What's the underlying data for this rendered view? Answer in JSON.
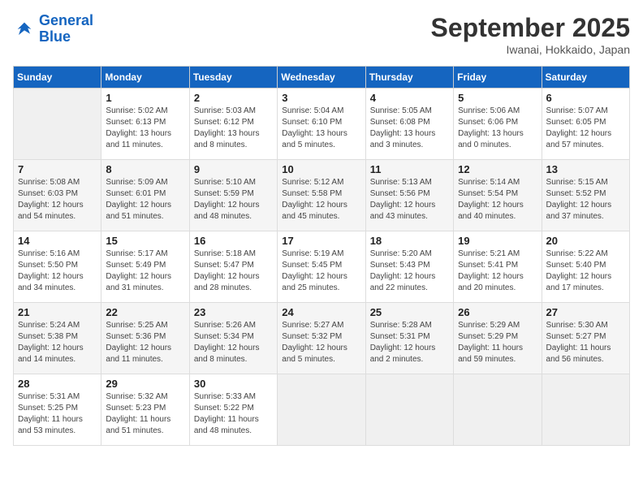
{
  "header": {
    "logo_line1": "General",
    "logo_line2": "Blue",
    "month": "September 2025",
    "location": "Iwanai, Hokkaido, Japan"
  },
  "columns": [
    "Sunday",
    "Monday",
    "Tuesday",
    "Wednesday",
    "Thursday",
    "Friday",
    "Saturday"
  ],
  "weeks": [
    [
      {
        "day": "",
        "info": ""
      },
      {
        "day": "1",
        "info": "Sunrise: 5:02 AM\nSunset: 6:13 PM\nDaylight: 13 hours\nand 11 minutes."
      },
      {
        "day": "2",
        "info": "Sunrise: 5:03 AM\nSunset: 6:12 PM\nDaylight: 13 hours\nand 8 minutes."
      },
      {
        "day": "3",
        "info": "Sunrise: 5:04 AM\nSunset: 6:10 PM\nDaylight: 13 hours\nand 5 minutes."
      },
      {
        "day": "4",
        "info": "Sunrise: 5:05 AM\nSunset: 6:08 PM\nDaylight: 13 hours\nand 3 minutes."
      },
      {
        "day": "5",
        "info": "Sunrise: 5:06 AM\nSunset: 6:06 PM\nDaylight: 13 hours\nand 0 minutes."
      },
      {
        "day": "6",
        "info": "Sunrise: 5:07 AM\nSunset: 6:05 PM\nDaylight: 12 hours\nand 57 minutes."
      }
    ],
    [
      {
        "day": "7",
        "info": "Sunrise: 5:08 AM\nSunset: 6:03 PM\nDaylight: 12 hours\nand 54 minutes."
      },
      {
        "day": "8",
        "info": "Sunrise: 5:09 AM\nSunset: 6:01 PM\nDaylight: 12 hours\nand 51 minutes."
      },
      {
        "day": "9",
        "info": "Sunrise: 5:10 AM\nSunset: 5:59 PM\nDaylight: 12 hours\nand 48 minutes."
      },
      {
        "day": "10",
        "info": "Sunrise: 5:12 AM\nSunset: 5:58 PM\nDaylight: 12 hours\nand 45 minutes."
      },
      {
        "day": "11",
        "info": "Sunrise: 5:13 AM\nSunset: 5:56 PM\nDaylight: 12 hours\nand 43 minutes."
      },
      {
        "day": "12",
        "info": "Sunrise: 5:14 AM\nSunset: 5:54 PM\nDaylight: 12 hours\nand 40 minutes."
      },
      {
        "day": "13",
        "info": "Sunrise: 5:15 AM\nSunset: 5:52 PM\nDaylight: 12 hours\nand 37 minutes."
      }
    ],
    [
      {
        "day": "14",
        "info": "Sunrise: 5:16 AM\nSunset: 5:50 PM\nDaylight: 12 hours\nand 34 minutes."
      },
      {
        "day": "15",
        "info": "Sunrise: 5:17 AM\nSunset: 5:49 PM\nDaylight: 12 hours\nand 31 minutes."
      },
      {
        "day": "16",
        "info": "Sunrise: 5:18 AM\nSunset: 5:47 PM\nDaylight: 12 hours\nand 28 minutes."
      },
      {
        "day": "17",
        "info": "Sunrise: 5:19 AM\nSunset: 5:45 PM\nDaylight: 12 hours\nand 25 minutes."
      },
      {
        "day": "18",
        "info": "Sunrise: 5:20 AM\nSunset: 5:43 PM\nDaylight: 12 hours\nand 22 minutes."
      },
      {
        "day": "19",
        "info": "Sunrise: 5:21 AM\nSunset: 5:41 PM\nDaylight: 12 hours\nand 20 minutes."
      },
      {
        "day": "20",
        "info": "Sunrise: 5:22 AM\nSunset: 5:40 PM\nDaylight: 12 hours\nand 17 minutes."
      }
    ],
    [
      {
        "day": "21",
        "info": "Sunrise: 5:24 AM\nSunset: 5:38 PM\nDaylight: 12 hours\nand 14 minutes."
      },
      {
        "day": "22",
        "info": "Sunrise: 5:25 AM\nSunset: 5:36 PM\nDaylight: 12 hours\nand 11 minutes."
      },
      {
        "day": "23",
        "info": "Sunrise: 5:26 AM\nSunset: 5:34 PM\nDaylight: 12 hours\nand 8 minutes."
      },
      {
        "day": "24",
        "info": "Sunrise: 5:27 AM\nSunset: 5:32 PM\nDaylight: 12 hours\nand 5 minutes."
      },
      {
        "day": "25",
        "info": "Sunrise: 5:28 AM\nSunset: 5:31 PM\nDaylight: 12 hours\nand 2 minutes."
      },
      {
        "day": "26",
        "info": "Sunrise: 5:29 AM\nSunset: 5:29 PM\nDaylight: 11 hours\nand 59 minutes."
      },
      {
        "day": "27",
        "info": "Sunrise: 5:30 AM\nSunset: 5:27 PM\nDaylight: 11 hours\nand 56 minutes."
      }
    ],
    [
      {
        "day": "28",
        "info": "Sunrise: 5:31 AM\nSunset: 5:25 PM\nDaylight: 11 hours\nand 53 minutes."
      },
      {
        "day": "29",
        "info": "Sunrise: 5:32 AM\nSunset: 5:23 PM\nDaylight: 11 hours\nand 51 minutes."
      },
      {
        "day": "30",
        "info": "Sunrise: 5:33 AM\nSunset: 5:22 PM\nDaylight: 11 hours\nand 48 minutes."
      },
      {
        "day": "",
        "info": ""
      },
      {
        "day": "",
        "info": ""
      },
      {
        "day": "",
        "info": ""
      },
      {
        "day": "",
        "info": ""
      }
    ]
  ]
}
